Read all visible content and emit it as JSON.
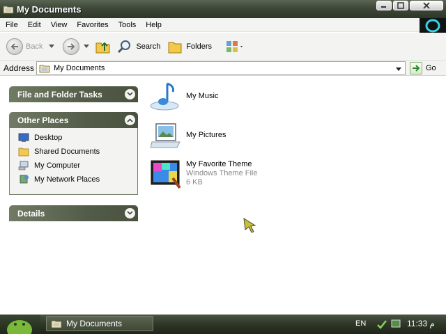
{
  "window": {
    "title": "My Documents"
  },
  "menu": {
    "items": [
      "File",
      "Edit",
      "View",
      "Favorites",
      "Tools",
      "Help"
    ]
  },
  "toolbar": {
    "back_label": "Back",
    "search_label": "Search",
    "folders_label": "Folders"
  },
  "address": {
    "label": "Address",
    "value": "My Documents",
    "go_label": "Go"
  },
  "tasks": {
    "file_folder_title": "File and Folder Tasks",
    "other_places_title": "Other Places",
    "other_places": [
      "Desktop",
      "Shared Documents",
      "My Computer",
      "My Network Places"
    ],
    "details_title": "Details"
  },
  "files": [
    {
      "name": "My Music",
      "icon": "music-folder-icon"
    },
    {
      "name": "My Pictures",
      "icon": "pictures-folder-icon"
    },
    {
      "name": "My Favorite Theme",
      "type": "Windows Theme File",
      "size": "6 KB",
      "icon": "theme-file-icon"
    }
  ],
  "taskbar": {
    "task_label": "My Documents",
    "language": "EN",
    "clock": "11:33",
    "clock_suffix": "م"
  },
  "colors": {
    "titlebar": "#3e4838",
    "panel_head": "#525c48",
    "taskbar": "#2e3628"
  }
}
